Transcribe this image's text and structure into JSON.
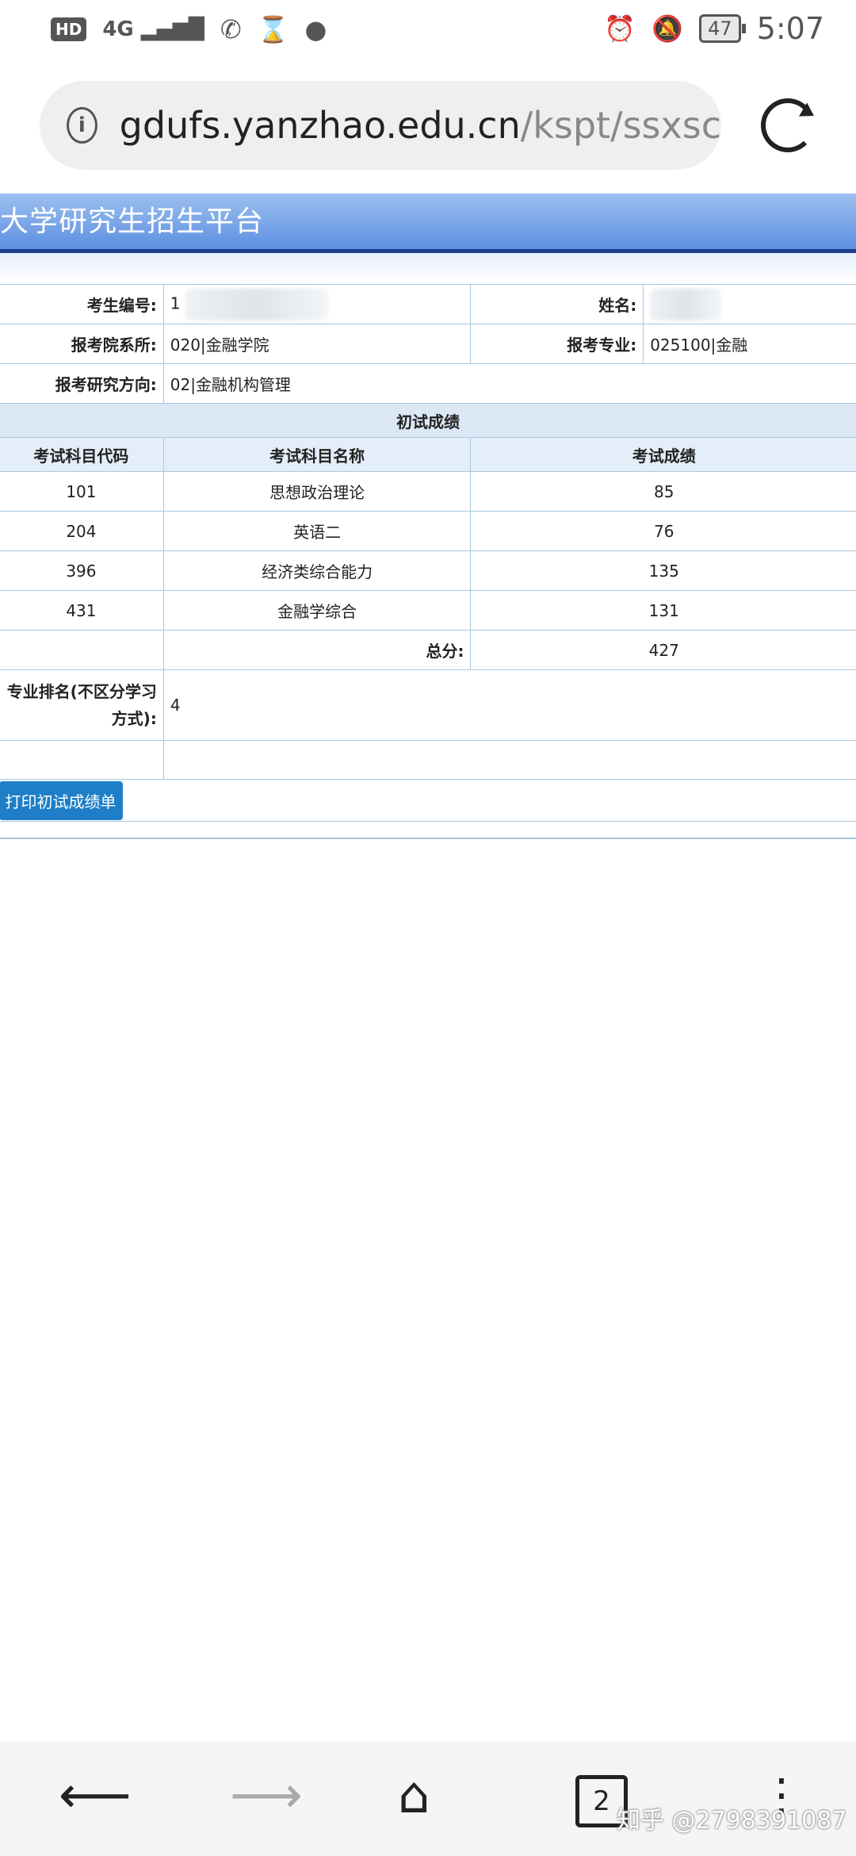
{
  "status_bar": {
    "hd": "HD",
    "network": "4G",
    "battery": "47",
    "time": "5:07"
  },
  "browser": {
    "url_host": "gdufs.yanzhao.edu.cn",
    "url_path": "/kspt/ssxsc",
    "tab_count": "2"
  },
  "page": {
    "title": "大学研究生招生平台"
  },
  "info": {
    "exam_id_label": "考生编号:",
    "exam_id_value": "1",
    "name_label": "姓名:",
    "dept_label": "报考院系所:",
    "dept_value": "020|金融学院",
    "major_label": "报考专业:",
    "major_value": "025100|金融",
    "direction_label": "报考研究方向:",
    "direction_value": "02|金融机构管理"
  },
  "scores": {
    "section_title": "初试成绩",
    "headers": [
      "考试科目代码",
      "考试科目名称",
      "考试成绩"
    ],
    "rows": [
      {
        "code": "101",
        "name": "思想政治理论",
        "score": "85"
      },
      {
        "code": "204",
        "name": "英语二",
        "score": "76"
      },
      {
        "code": "396",
        "name": "经济类综合能力",
        "score": "135"
      },
      {
        "code": "431",
        "name": "金融学综合",
        "score": "131"
      }
    ],
    "total_label": "总分:",
    "total_value": "427",
    "rank_label": "专业排名(不区分学习方式):",
    "rank_value": "4",
    "print_button": "打印初试成绩单"
  },
  "watermark": "知乎 @2798391087"
}
